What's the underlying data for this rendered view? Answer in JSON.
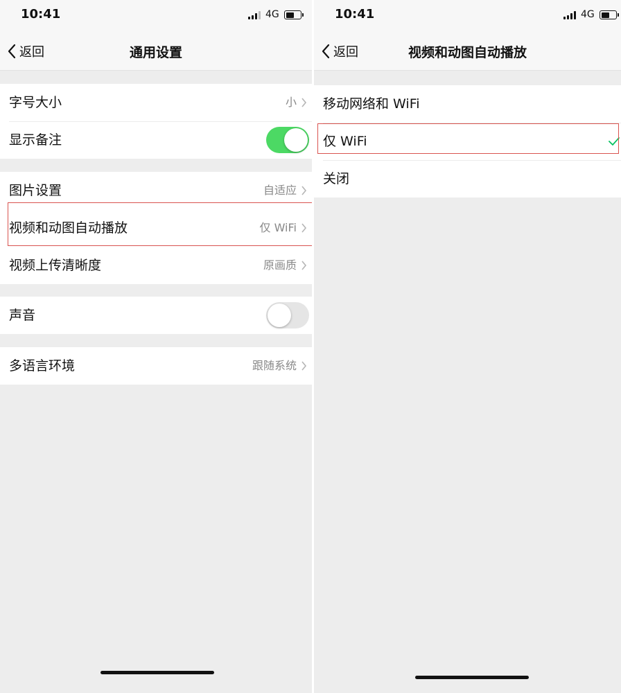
{
  "status_bar": {
    "time": "10:41",
    "network": "4G"
  },
  "left_screen": {
    "nav": {
      "back_label": "返回",
      "title": "通用设置"
    },
    "groups": [
      {
        "rows": [
          {
            "label": "字号大小",
            "value": "小",
            "chevron": true
          },
          {
            "label": "显示备注",
            "toggle": "on"
          }
        ]
      },
      {
        "rows": [
          {
            "label": "图片设置",
            "value": "自适应",
            "chevron": true
          },
          {
            "label": "视频和动图自动播放",
            "value": "仅 WiFi",
            "chevron": true,
            "highlighted": true
          },
          {
            "label": "视频上传清晰度",
            "value": "原画质",
            "chevron": true
          }
        ]
      },
      {
        "rows": [
          {
            "label": "声音",
            "toggle": "off"
          }
        ]
      },
      {
        "rows": [
          {
            "label": "多语言环境",
            "value": "跟随系统",
            "chevron": true
          }
        ]
      }
    ]
  },
  "right_screen": {
    "nav": {
      "back_label": "返回",
      "title": "视频和动图自动播放"
    },
    "options": [
      {
        "label": "移动网络和 WiFi",
        "selected": false
      },
      {
        "label": "仅 WiFi",
        "selected": true,
        "highlighted": true
      },
      {
        "label": "关闭",
        "selected": false
      }
    ]
  },
  "colors": {
    "toggle_on": "#4cd964",
    "toggle_off": "#e5e5e5",
    "highlight_border": "#d9534f",
    "checkmark": "#07c160",
    "background": "#ededed"
  },
  "icons": [
    "back-chevron-icon",
    "chevron-right-icon",
    "checkmark-icon",
    "signal-icon",
    "battery-icon"
  ]
}
